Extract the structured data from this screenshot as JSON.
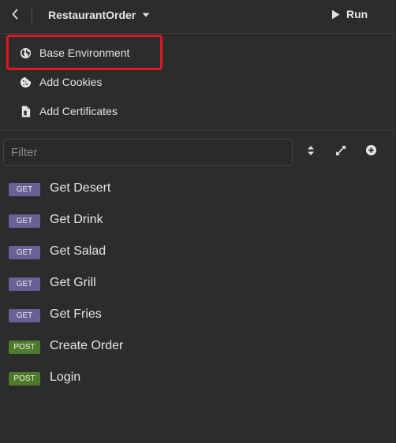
{
  "header": {
    "back_icon": "chevron-left-icon",
    "project_name": "RestaurantOrder",
    "dropdown_icon": "caret-down-icon",
    "run_label": "Run",
    "run_icon": "play-icon"
  },
  "env_menu": {
    "items": [
      {
        "label": "Base Environment",
        "icon": "globe-icon"
      },
      {
        "label": "Add Cookies",
        "icon": "cookie-icon"
      },
      {
        "label": "Add Certificates",
        "icon": "certificate-file-icon"
      }
    ],
    "highlight_color": "#e0161e"
  },
  "filter": {
    "placeholder": "Filter",
    "value": ""
  },
  "toolbar_icons": [
    "sort-icon",
    "expand-icon",
    "add-icon"
  ],
  "requests": [
    {
      "method": "GET",
      "name": "Get Desert"
    },
    {
      "method": "GET",
      "name": "Get Drink"
    },
    {
      "method": "GET",
      "name": "Get Salad"
    },
    {
      "method": "GET",
      "name": "Get Grill"
    },
    {
      "method": "GET",
      "name": "Get Fries"
    },
    {
      "method": "POST",
      "name": "Create Order"
    },
    {
      "method": "POST",
      "name": "Login"
    }
  ],
  "colors": {
    "background": "#2c2c2c",
    "get_badge": "#6a5f96",
    "post_badge": "#4f7a2c"
  }
}
